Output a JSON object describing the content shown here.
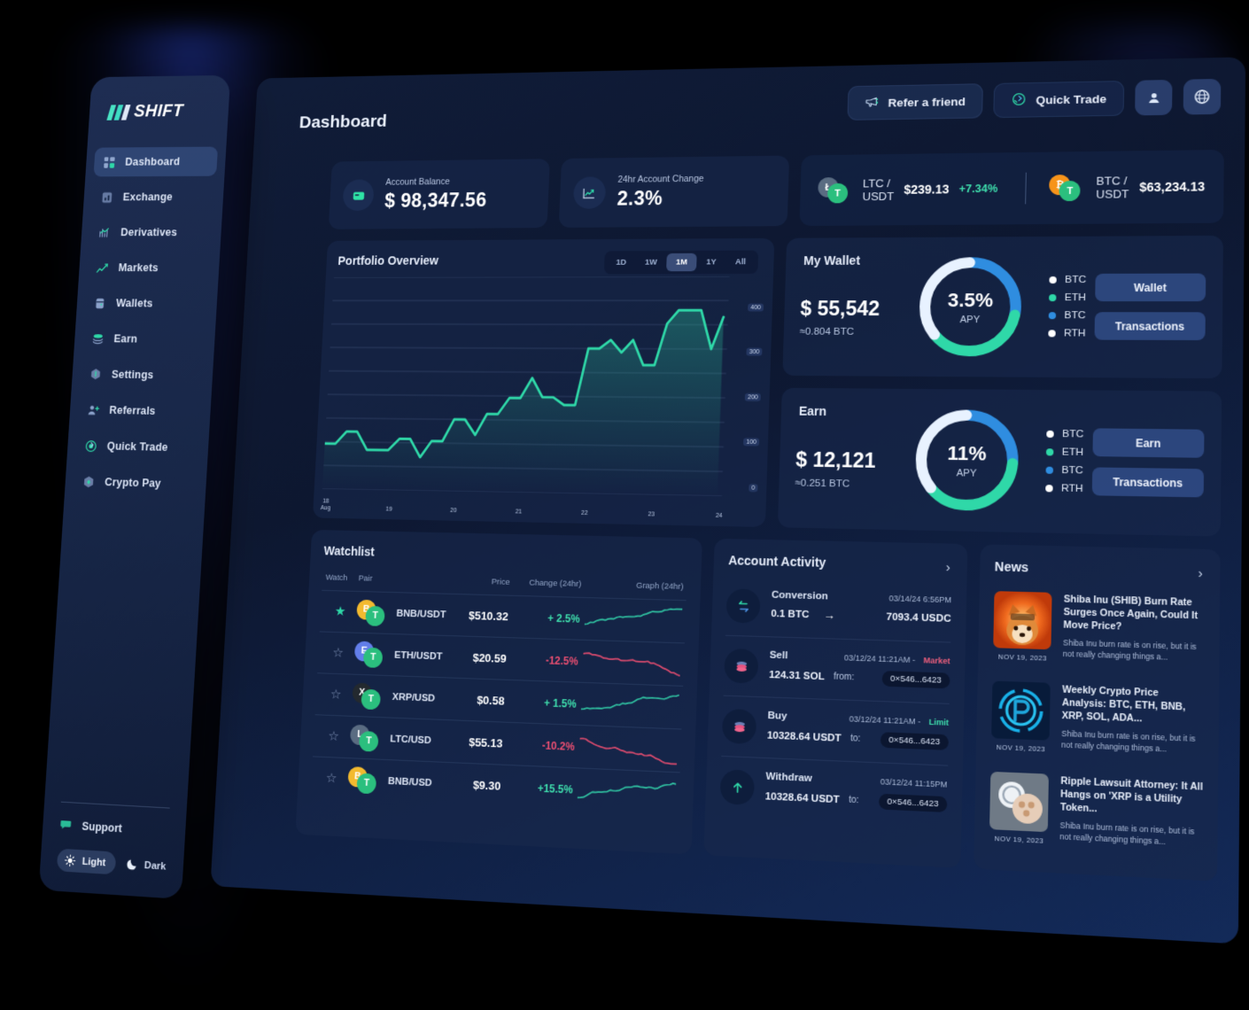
{
  "brand": {
    "name": "SHIFT"
  },
  "header": {
    "title": "Dashboard",
    "refer_label": "Refer a friend",
    "quick_trade_label": "Quick Trade"
  },
  "sidebar": {
    "items": [
      {
        "label": "Dashboard",
        "icon": "dashboard-icon",
        "active": true
      },
      {
        "label": "Exchange",
        "icon": "exchange-icon",
        "active": false
      },
      {
        "label": "Derivatives",
        "icon": "derivatives-icon",
        "active": false
      },
      {
        "label": "Markets",
        "icon": "markets-icon",
        "active": false
      },
      {
        "label": "Wallets",
        "icon": "wallets-icon",
        "active": false
      },
      {
        "label": "Earn",
        "icon": "earn-icon",
        "active": false
      },
      {
        "label": "Settings",
        "icon": "settings-icon",
        "active": false
      },
      {
        "label": "Referrals",
        "icon": "referrals-icon",
        "active": false
      },
      {
        "label": "Quick Trade",
        "icon": "quick-trade-icon",
        "active": false
      },
      {
        "label": "Crypto Pay",
        "icon": "crypto-pay-icon",
        "active": false
      }
    ],
    "support_label": "Support",
    "theme_light": "Light",
    "theme_dark": "Dark"
  },
  "stats": [
    {
      "label": "Account Balance",
      "value": "$ 98,347.56",
      "icon": "wallet-icon"
    },
    {
      "label": "24hr Account Change",
      "value": "2.3%",
      "icon": "chart-up-icon"
    }
  ],
  "tickers": [
    {
      "pair": "LTC / USDT",
      "price": "$239.13",
      "change": "+7.34%",
      "color": "#5a6c82",
      "symbol": "L"
    },
    {
      "pair": "BTC / USDT",
      "price": "$63,234.13",
      "change": "",
      "color": "#f7941a",
      "symbol": "B"
    }
  ],
  "portfolio": {
    "title": "Portfolio Overview",
    "ranges": [
      "1D",
      "1W",
      "1M",
      "1Y",
      "All"
    ],
    "active_range": "1M"
  },
  "chart_data": {
    "type": "line",
    "title": "Portfolio Overview",
    "xlabel": "",
    "ylabel": "",
    "grid": true,
    "legend": "none",
    "ylim": [
      0,
      450
    ],
    "yticks": [
      400,
      300,
      200,
      100,
      0
    ],
    "xticks": [
      "18 Aug",
      "19",
      "20",
      "21",
      "22",
      "23",
      "24"
    ],
    "x": [
      0,
      1,
      2,
      3,
      4,
      5,
      6,
      7,
      8,
      9,
      10,
      11,
      12,
      13,
      14,
      15,
      16,
      17,
      18,
      19,
      20,
      21,
      22,
      23,
      24,
      25,
      26,
      27,
      28,
      29,
      30,
      31,
      32,
      33,
      34,
      35
    ],
    "series": [
      {
        "name": "Portfolio value",
        "color": "#2fd8a8",
        "values": [
          96,
          96,
          122,
          122,
          84,
          84,
          84,
          108,
          108,
          70,
          104,
          104,
          150,
          150,
          118,
          162,
          162,
          196,
          196,
          238,
          198,
          198,
          182,
          182,
          300,
          300,
          318,
          292,
          318,
          266,
          266,
          352,
          380,
          380,
          380,
          300,
          366
        ]
      }
    ]
  },
  "wallet": {
    "title": "My Wallet",
    "percent": "3.5%",
    "apy_label": "APY",
    "amount": "$ 55,542",
    "sub": "≈0.804 BTC",
    "legend": [
      {
        "label": "BTC",
        "color": "#ffffff"
      },
      {
        "label": "ETH",
        "color": "#2fd8a8"
      },
      {
        "label": "BTC",
        "color": "#2f8de0"
      },
      {
        "label": "RTH",
        "color": "#ffffff"
      }
    ],
    "buttons": [
      "Wallet",
      "Transactions"
    ],
    "donut_segments": [
      {
        "label": "BTC",
        "color": "#2f8de0",
        "percent": 28
      },
      {
        "label": "ETH",
        "color": "#2fd8a8",
        "percent": 36
      },
      {
        "label": "RTH",
        "color": "#e8f2ff",
        "percent": 36
      }
    ]
  },
  "earn": {
    "title": "Earn",
    "percent": "11%",
    "apy_label": "APY",
    "amount": "$ 12,121",
    "sub": "≈0.251 BTC",
    "legend": [
      {
        "label": "BTC",
        "color": "#ffffff"
      },
      {
        "label": "ETH",
        "color": "#2fd8a8"
      },
      {
        "label": "BTC",
        "color": "#2f8de0"
      },
      {
        "label": "RTH",
        "color": "#ffffff"
      }
    ],
    "buttons": [
      "Earn",
      "Transactions"
    ],
    "donut_segments": [
      {
        "label": "BTC",
        "color": "#2f8de0",
        "percent": 26
      },
      {
        "label": "ETH",
        "color": "#2fd8a8",
        "percent": 38
      },
      {
        "label": "RTH",
        "color": "#e8f2ff",
        "percent": 36
      }
    ]
  },
  "watchlist": {
    "title": "Watchlist",
    "columns": [
      "Watch",
      "Pair",
      "Price",
      "Change (24hr)",
      "Graph (24hr)"
    ],
    "rows": [
      {
        "starred": true,
        "pair": "BNB/USDT",
        "price": "$510.32",
        "change": "+ 2.5%",
        "direction": "up",
        "coin_color": "#f3ba2f",
        "coin_symbol": "B"
      },
      {
        "starred": false,
        "pair": "ETH/USDT",
        "price": "$20.59",
        "change": "-12.5%",
        "direction": "down",
        "coin_color": "#627eea",
        "coin_symbol": "E"
      },
      {
        "starred": false,
        "pair": "XRP/USD",
        "price": "$0.58",
        "change": "+ 1.5%",
        "direction": "up",
        "coin_color": "#23292f",
        "coin_symbol": "X"
      },
      {
        "starred": false,
        "pair": "LTC/USD",
        "price": "$55.13",
        "change": "-10.2%",
        "direction": "down",
        "coin_color": "#5a6c82",
        "coin_symbol": "L"
      },
      {
        "starred": false,
        "pair": "BNB/USD",
        "price": "$9.30",
        "change": "+15.5%",
        "direction": "up",
        "coin_color": "#f3ba2f",
        "coin_symbol": "B"
      }
    ]
  },
  "activity": {
    "title": "Account Activity",
    "rows": [
      {
        "type": "Conversion",
        "time": "03/14/24 6:56PM",
        "tag": "",
        "tag_kind": "",
        "amount": "0.1 BTC",
        "mid": "→",
        "right": "7093.4 USDC",
        "icon": "swap-icon"
      },
      {
        "type": "Sell",
        "time": "03/12/24  11:21AM -",
        "tag": "Market",
        "tag_kind": "market",
        "amount": "124.31 SOL",
        "mid": "from:",
        "right": "0×546...6423",
        "icon": "coins-icon"
      },
      {
        "type": "Buy",
        "time": "03/12/24  11:21AM -",
        "tag": "Limit",
        "tag_kind": "limit",
        "amount": "10328.64 USDT",
        "mid": "to:",
        "right": "0×546...6423",
        "icon": "coins-icon"
      },
      {
        "type": "Withdraw",
        "time": "03/12/24 11:15PM",
        "tag": "",
        "tag_kind": "",
        "amount": "10328.64 USDT",
        "mid": "to:",
        "right": "0×546...6423",
        "icon": "withdraw-icon"
      }
    ]
  },
  "news": {
    "title": "News",
    "items": [
      {
        "title": "Shiba Inu (SHIB) Burn Rate Surges Once Again, Could It Move Price?",
        "desc": "Shiba Inu burn rate is on rise, but it is not really changing things a...",
        "date": "NOV 19, 2023",
        "thumb": "shiba-inu-thumb"
      },
      {
        "title": "Weekly Crypto Price Analysis: BTC, ETH, BNB, XRP, SOL, ADA...",
        "desc": "Shiba Inu burn rate is on rise, but it is not really changing things a...",
        "date": "NOV 19, 2023",
        "thumb": "crypto-analysis-thumb"
      },
      {
        "title": "Ripple Lawsuit Attorney: It All Hangs on 'XRP is a Utility Token...",
        "desc": "Shiba Inu burn rate is on rise, but it is not really changing things a...",
        "date": "NOV 19, 2023",
        "thumb": "ripple-thumb"
      }
    ]
  },
  "colors": {
    "accent_green": "#2fd8a8",
    "accent_blue": "#2f8de0",
    "down_red": "#ec4f72",
    "panel": "#18284c",
    "background": "#0d1730"
  }
}
